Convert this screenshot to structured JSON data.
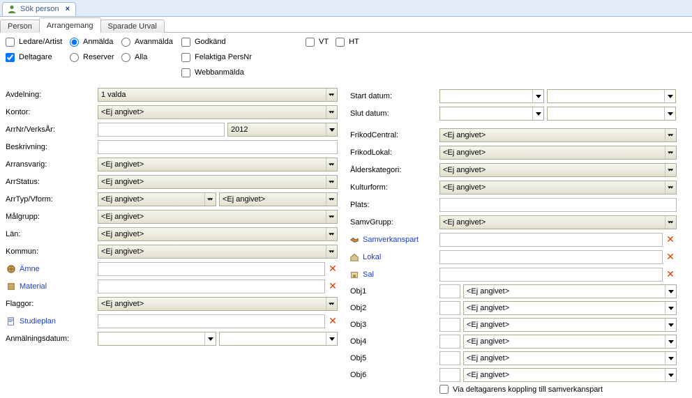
{
  "topTab": {
    "title": "Sök person"
  },
  "subTabs": {
    "person": "Person",
    "arrangemang": "Arrangemang",
    "sparade": "Sparade Urval"
  },
  "left": {
    "ledare": "Ledare/Artist",
    "deltagare": "Deltagare",
    "anmalda": "Anmälda",
    "avanmalda": "Avanmälda",
    "reserver": "Reserver",
    "alla": "Alla",
    "godkand": "Godkänd",
    "felaktiga": "Felaktiga PersNr",
    "webbanmalda": "Webbanmälda",
    "vt": "VT",
    "ht": "HT",
    "avdelning": {
      "label": "Avdelning:",
      "value": "1 valda"
    },
    "kontor": {
      "label": "Kontor:",
      "value": "<Ej angivet>"
    },
    "arrnr": {
      "label": "ArrNr/VerksÅr:",
      "value": "",
      "year": "2012"
    },
    "beskrivning": {
      "label": "Beskrivning:",
      "value": ""
    },
    "arransvarig": {
      "label": "Arransvarig:",
      "value": "<Ej angivet>"
    },
    "arrstatus": {
      "label": "ArrStatus:",
      "value": "<Ej angivet>"
    },
    "arrtyp": {
      "label": "ArrTyp/Vform:",
      "value1": "<Ej angivet>",
      "value2": "<Ej angivet>"
    },
    "malgrupp": {
      "label": "Målgrupp:",
      "value": "<Ej angivet>"
    },
    "lan": {
      "label": "Län:",
      "value": "<Ej angivet>"
    },
    "kommun": {
      "label": "Kommun:",
      "value": "<Ej angivet>"
    },
    "amne": {
      "label": "Ämne",
      "value": ""
    },
    "material": {
      "label": "Material",
      "value": ""
    },
    "flaggor": {
      "label": "Flaggor:",
      "value": "<Ej angivet>"
    },
    "studieplan": {
      "label": "Studieplan",
      "value": ""
    },
    "anmdatum": {
      "label": "Anmälningsdatum:",
      "value1": "",
      "value2": ""
    }
  },
  "right": {
    "startdatum": {
      "label": "Start datum:",
      "v1": "",
      "v2": ""
    },
    "slutdatum": {
      "label": "Slut datum:",
      "v1": "",
      "v2": ""
    },
    "frikodcentral": {
      "label": "FrikodCentral:",
      "value": "<Ej angivet>"
    },
    "frikodlokal": {
      "label": "FrikodLokal:",
      "value": "<Ej angivet>"
    },
    "alderskat": {
      "label": "Ålderskategori:",
      "value": "<Ej angivet>"
    },
    "kulturform": {
      "label": "Kulturform:",
      "value": "<Ej angivet>"
    },
    "plats": {
      "label": "Plats:",
      "value": ""
    },
    "samvgrupp": {
      "label": "SamvGrupp:",
      "value": "<Ej angivet>"
    },
    "samverkanspart": {
      "label": "Samverkanspart",
      "value": ""
    },
    "lokal": {
      "label": "Lokal",
      "value": ""
    },
    "sal": {
      "label": "Sal",
      "value": ""
    },
    "obj1": {
      "label": "Obj1",
      "t": "",
      "d": "<Ej angivet>"
    },
    "obj2": {
      "label": "Obj2",
      "t": "",
      "d": "<Ej angivet>"
    },
    "obj3": {
      "label": "Obj3",
      "t": "",
      "d": "<Ej angivet>"
    },
    "obj4": {
      "label": "Obj4",
      "t": "",
      "d": "<Ej angivet>"
    },
    "obj5": {
      "label": "Obj5",
      "t": "",
      "d": "<Ej angivet>"
    },
    "obj6": {
      "label": "Obj6",
      "t": "",
      "d": "<Ej angivet>"
    },
    "viadeltag": "Via deltagarens koppling till samverkanspart"
  }
}
